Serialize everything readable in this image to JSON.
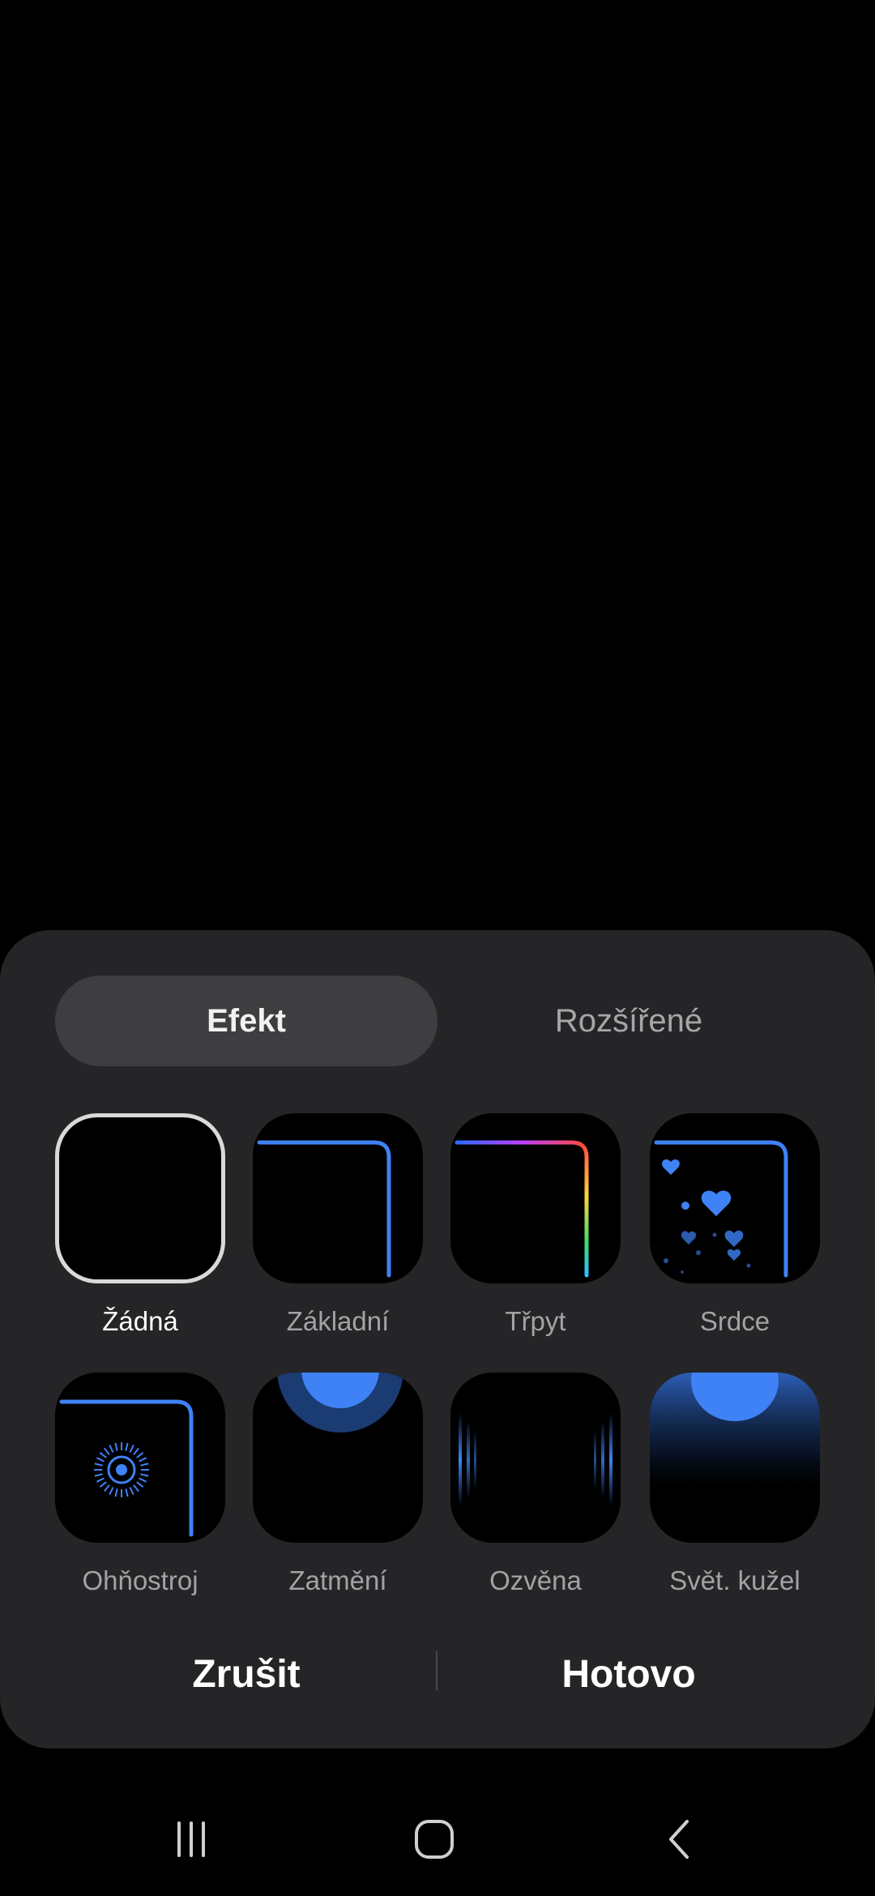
{
  "tabs": {
    "effect": "Efekt",
    "advanced": "Rozšířené",
    "active": "effect"
  },
  "effects": [
    {
      "label": "Žádná",
      "icon": "none-effect-icon",
      "selected": true
    },
    {
      "label": "Základní",
      "icon": "basic-effect-icon",
      "selected": false
    },
    {
      "label": "Třpyt",
      "icon": "glitter-effect-icon",
      "selected": false
    },
    {
      "label": "Srdce",
      "icon": "hearts-effect-icon",
      "selected": false
    },
    {
      "label": "Ohňostroj",
      "icon": "fireworks-effect-icon",
      "selected": false
    },
    {
      "label": "Zatmění",
      "icon": "eclipse-effect-icon",
      "selected": false
    },
    {
      "label": "Ozvěna",
      "icon": "echo-effect-icon",
      "selected": false
    },
    {
      "label": "Světelný kužel",
      "label_display": "Svět. kužel",
      "icon": "spotlight-effect-icon",
      "selected": false
    }
  ],
  "buttons": {
    "cancel": "Zrušit",
    "done": "Hotovo"
  },
  "navbar": {
    "recents": "recents-icon",
    "home": "home-icon",
    "back": "back-icon"
  },
  "colors": {
    "accent": "#3f82f6",
    "sheet_background": "#252527",
    "active_tab_background": "#3e3e40"
  }
}
